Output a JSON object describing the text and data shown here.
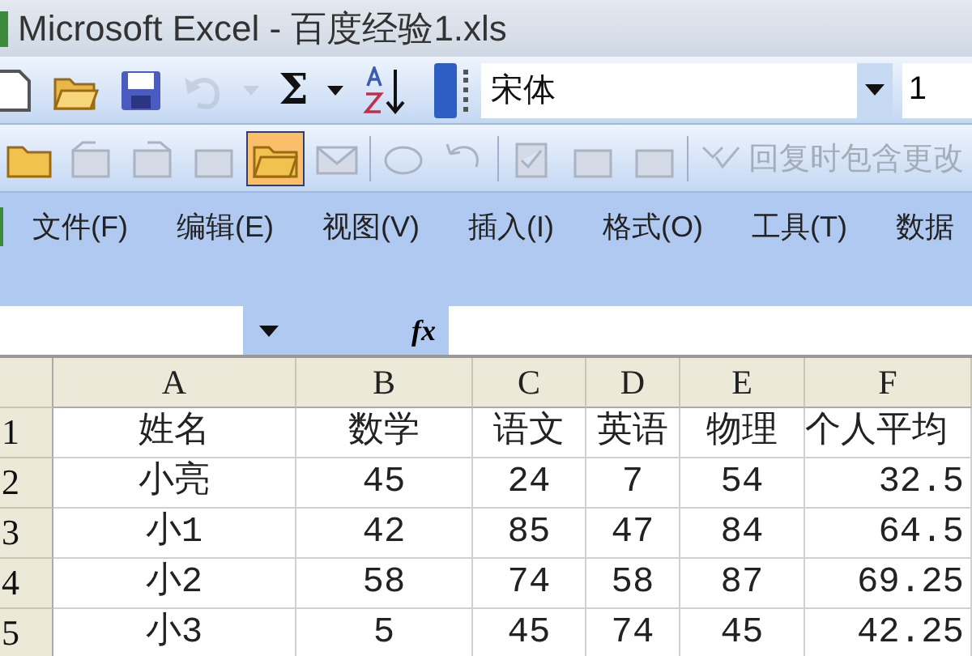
{
  "window": {
    "title": "Microsoft Excel - 百度经验1.xls"
  },
  "standard_toolbar": [
    {
      "kind": "new",
      "disabled": false
    },
    {
      "kind": "open",
      "disabled": false
    },
    {
      "kind": "save",
      "disabled": false
    },
    {
      "kind": "undo",
      "disabled": true
    },
    {
      "kind": "caret",
      "disabled": true
    },
    {
      "kind": "sum",
      "disabled": false,
      "text": "Σ"
    },
    {
      "kind": "caret",
      "disabled": false
    },
    {
      "kind": "sort",
      "disabled": false
    }
  ],
  "font": {
    "name": "宋体",
    "size": "1"
  },
  "reviewing_toolbar": [
    {
      "kind": "folder",
      "disabled": false,
      "on": false
    },
    {
      "kind": "back",
      "disabled": true,
      "on": false
    },
    {
      "kind": "forward",
      "disabled": true,
      "on": false
    },
    {
      "kind": "box",
      "disabled": true,
      "on": false
    },
    {
      "kind": "folders",
      "disabled": false,
      "on": true
    },
    {
      "kind": "mail",
      "disabled": true,
      "on": false
    },
    {
      "kind": "loop",
      "disabled": true,
      "on": false
    },
    {
      "kind": "undo",
      "disabled": true,
      "on": false
    },
    {
      "kind": "check",
      "disabled": true,
      "on": false
    },
    {
      "kind": "save",
      "disabled": true,
      "on": false
    },
    {
      "kind": "copy",
      "disabled": true,
      "on": false
    },
    {
      "kind": "reply",
      "disabled": true,
      "on": false,
      "text": "回复时包含更改"
    }
  ],
  "menu": [
    "文件(F)",
    "编辑(E)",
    "视图(V)",
    "插入(I)",
    "格式(O)",
    "工具(T)",
    "数据"
  ],
  "formula_bar": {
    "fx": "fx"
  },
  "sheet": {
    "columns": [
      "A",
      "B",
      "C",
      "D",
      "E",
      "F"
    ],
    "rows": [
      {
        "number": "1",
        "cells": [
          "姓名",
          "数学",
          "语文",
          "英语",
          "物理",
          "个人平均"
        ]
      },
      {
        "number": "2",
        "cells": [
          "小亮",
          "45",
          "24",
          "7",
          "54",
          "32.5"
        ]
      },
      {
        "number": "3",
        "cells": [
          "小1",
          "42",
          "85",
          "47",
          "84",
          "64.5"
        ]
      },
      {
        "number": "4",
        "cells": [
          "小2",
          "58",
          "74",
          "58",
          "87",
          "69.25"
        ]
      },
      {
        "number": "5",
        "cells": [
          "小3",
          "5",
          "45",
          "74",
          "45",
          "42.25"
        ]
      }
    ]
  }
}
